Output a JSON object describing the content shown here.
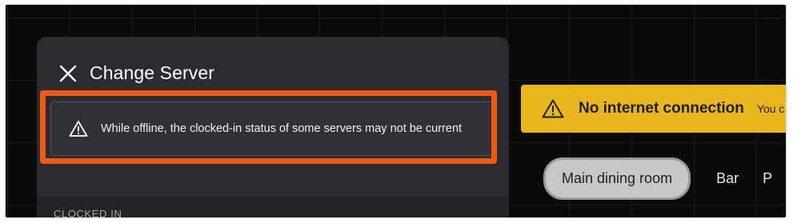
{
  "panel": {
    "title": "Change Server",
    "close_icon": "close-icon",
    "warning_icon": "warning-triangle-icon",
    "warning_text": "While offline, the clocked-in status of some servers may not be current",
    "section_label": "CLOCKED IN"
  },
  "banner": {
    "icon": "warning-triangle-icon",
    "title": "No internet connection",
    "subtitle": "You c"
  },
  "rooms": {
    "tabs": [
      {
        "label": "Main dining room",
        "active": true
      },
      {
        "label": "Bar",
        "active": false
      },
      {
        "label": "P",
        "active": false
      }
    ]
  },
  "colors": {
    "highlight": "#f05a12",
    "banner": "#e8b71c",
    "panel_bg": "#2b2c30",
    "page_bg": "#0a0a0a"
  }
}
